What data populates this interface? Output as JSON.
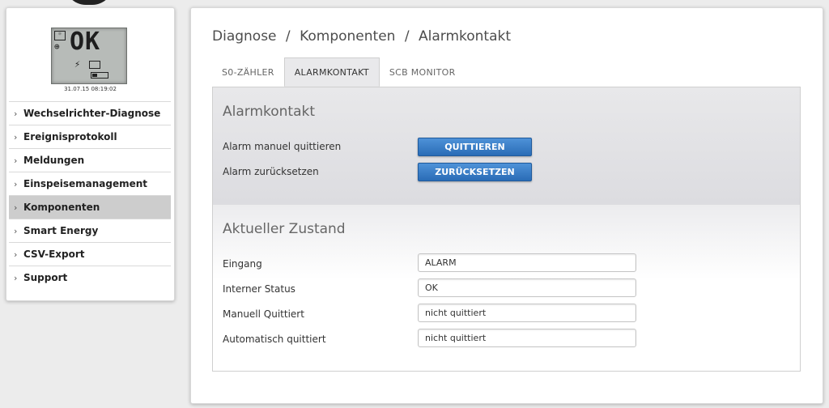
{
  "device": {
    "lcd_text": "OK",
    "timestamp": "31.07.15 08:19:02"
  },
  "sidebar": {
    "items": [
      {
        "label": "Wechselrichter-Diagnose",
        "active": false
      },
      {
        "label": "Ereignisprotokoll",
        "active": false
      },
      {
        "label": "Meldungen",
        "active": false
      },
      {
        "label": "Einspeisemanagement",
        "active": false
      },
      {
        "label": "Komponenten",
        "active": true
      },
      {
        "label": "Smart Energy",
        "active": false
      },
      {
        "label": "CSV-Export",
        "active": false
      },
      {
        "label": "Support",
        "active": false
      }
    ]
  },
  "breadcrumb": {
    "part1": "Diagnose",
    "sep": "/",
    "part2": "Komponenten",
    "part3": "Alarmkontakt"
  },
  "tabs": [
    {
      "label": "S0-ZÄHLER",
      "active": false
    },
    {
      "label": "ALARMKONTAKT",
      "active": true
    },
    {
      "label": "SCB MONITOR",
      "active": false
    }
  ],
  "alarm_section": {
    "title": "Alarmkontakt",
    "rows": [
      {
        "label": "Alarm manuel quittieren",
        "button": "QUITTIEREN"
      },
      {
        "label": "Alarm zurücksetzen",
        "button": "ZURÜCKSETZEN"
      }
    ]
  },
  "status_section": {
    "title": "Aktueller Zustand",
    "rows": [
      {
        "label": "Eingang",
        "value": "ALARM"
      },
      {
        "label": "Interner Status",
        "value": "OK"
      },
      {
        "label": "Manuell Quittiert",
        "value": "nicht quittiert"
      },
      {
        "label": "Automatisch quittiert",
        "value": "nicht quittiert"
      }
    ]
  }
}
